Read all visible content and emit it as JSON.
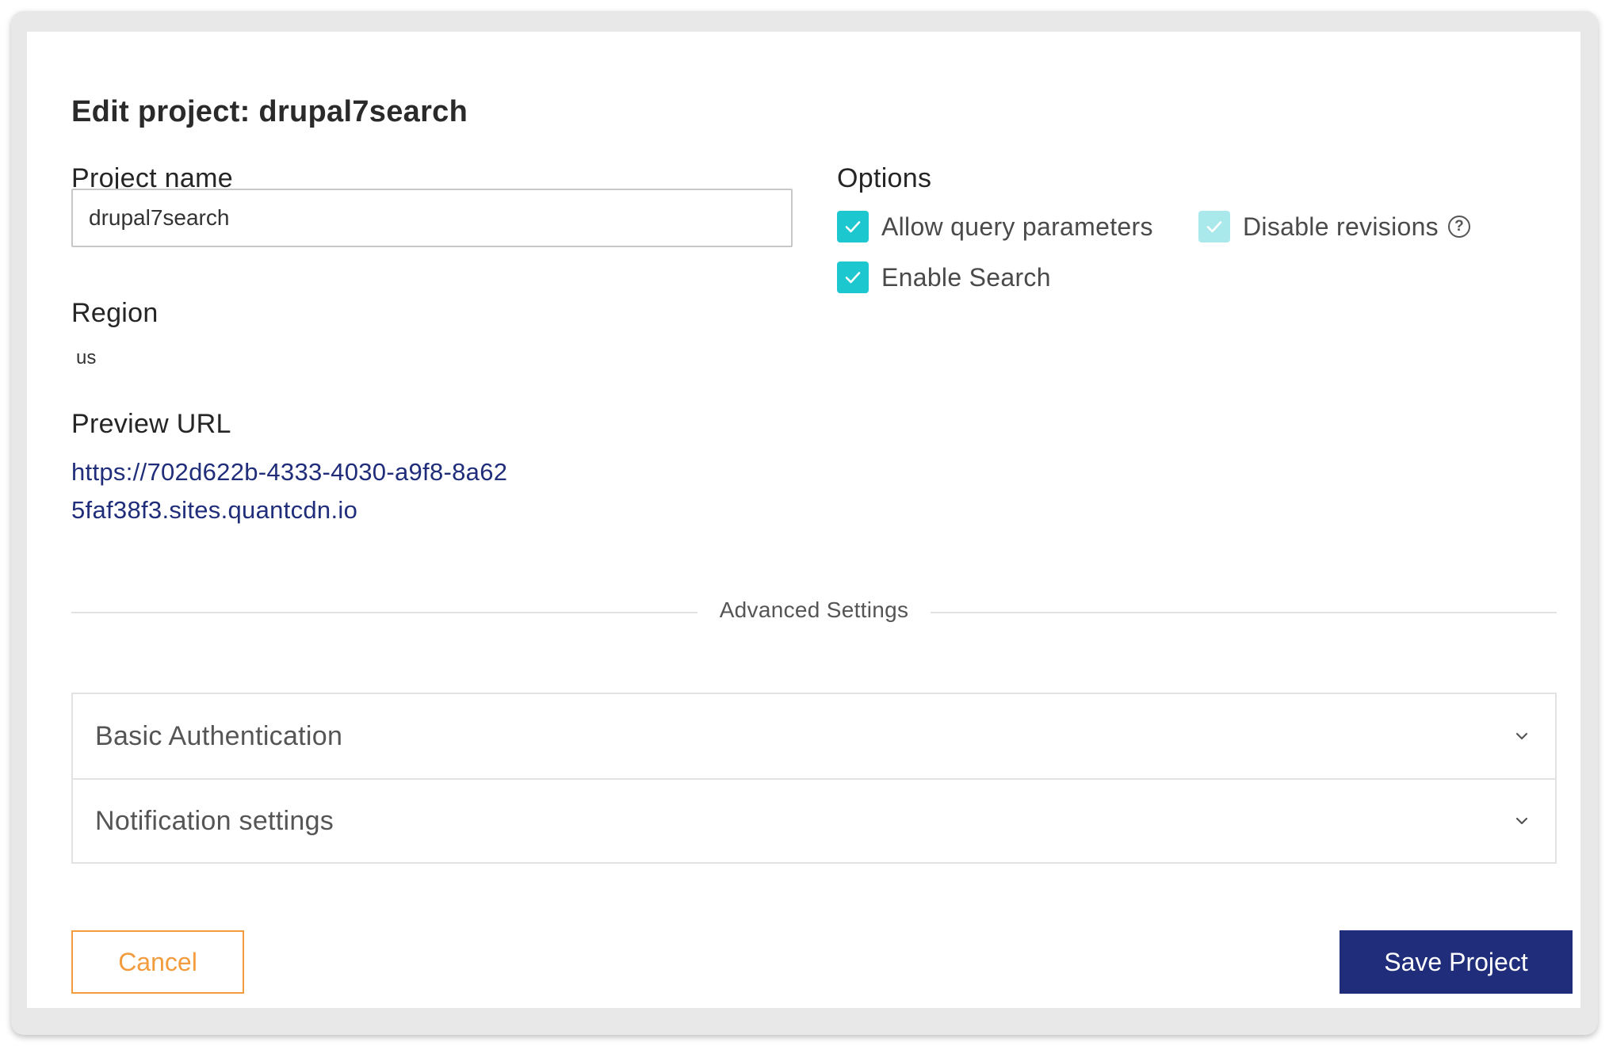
{
  "dialog": {
    "title": "Edit project: drupal7search"
  },
  "form": {
    "project_name_label": "Project name",
    "project_name_value": "drupal7search",
    "region_label": "Region",
    "region_value": "us",
    "preview_url_label": "Preview URL",
    "preview_url": "https://702d622b-4333-4030-a9f8-8a625faf38f3.sites.quantcdn.io"
  },
  "options": {
    "label": "Options",
    "allow_query_parameters": {
      "label": "Allow query parameters",
      "checked": true
    },
    "disable_revisions": {
      "label": "Disable revisions",
      "checked": true,
      "disabled": true,
      "help_icon": "question-circle-icon"
    },
    "enable_search": {
      "label": "Enable Search",
      "checked": true
    }
  },
  "advanced": {
    "divider_label": "Advanced Settings",
    "sections": [
      {
        "label": "Basic Authentication",
        "icon": "chevron-down-icon"
      },
      {
        "label": "Notification settings",
        "icon": "chevron-down-icon"
      }
    ]
  },
  "actions": {
    "cancel_label": "Cancel",
    "save_label": "Save Project"
  },
  "colors": {
    "primary": "#1f2d7a",
    "checkbox": "#1cc7cf",
    "checkbox_disabled": "#a9e9ec",
    "cancel": "#f39c3d"
  }
}
